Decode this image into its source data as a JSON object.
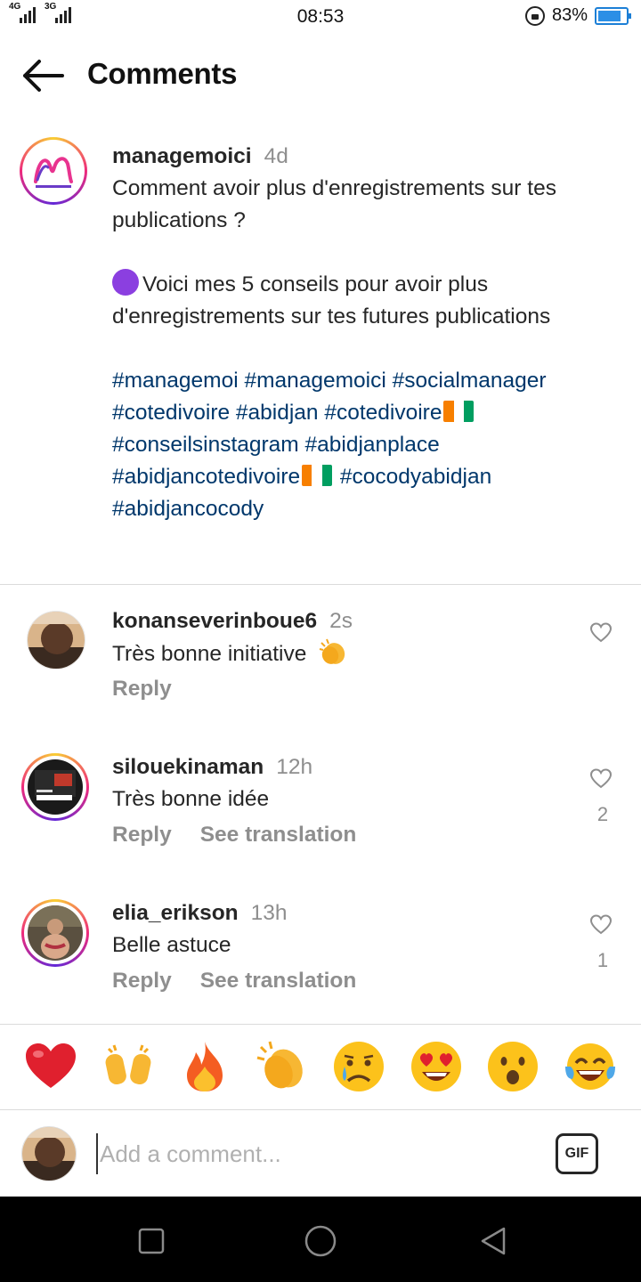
{
  "status_bar": {
    "network1": "4G",
    "network2": "3G",
    "time": "08:53",
    "battery": "83%",
    "battery_level": 0.83
  },
  "header": {
    "title": "Comments",
    "back_icon": "arrow-left-icon"
  },
  "caption": {
    "username": "managemoici",
    "time": "4d",
    "line1": "Comment avoir plus d'enregistrements sur tes publications ?",
    "line2": "Voici mes 5 conseils pour avoir plus d'enregistrements sur tes futures publications",
    "hashtags_1": "#managemoi #managemoici #socialmanager #cotedivoire #abidjan #cotedivoire",
    "hashtags_2": " #conseilsinstagram #abidjanplace #abidjancotedivoire",
    "hashtags_3": " #cocodyabidjan #abidjancocody"
  },
  "comments": [
    {
      "username": "konanseverinboue6",
      "time": "2s",
      "text": "Très bonne initiative",
      "emoji": "clapping-hands",
      "reply": "Reply",
      "see_translation": "",
      "likes": ""
    },
    {
      "username": "silouekinaman",
      "time": "12h",
      "text": "Très bonne idée",
      "reply": "Reply",
      "see_translation": "See translation",
      "likes": "2"
    },
    {
      "username": "elia_erikson",
      "time": "13h",
      "text": "Belle astuce",
      "reply": "Reply",
      "see_translation": "See translation",
      "likes": "1"
    }
  ],
  "reactions": [
    "red-heart",
    "raising-hands",
    "fire",
    "clapping-hands",
    "crying-face",
    "heart-eyes",
    "surprised-face",
    "tears-of-joy"
  ],
  "input": {
    "placeholder": "Add a comment...",
    "gif_label": "GIF"
  },
  "colors": {
    "hashtag": "#00376b",
    "secondary_text": "#8e8e8e",
    "flag_orange": "#f77f00",
    "flag_green": "#009e60"
  }
}
